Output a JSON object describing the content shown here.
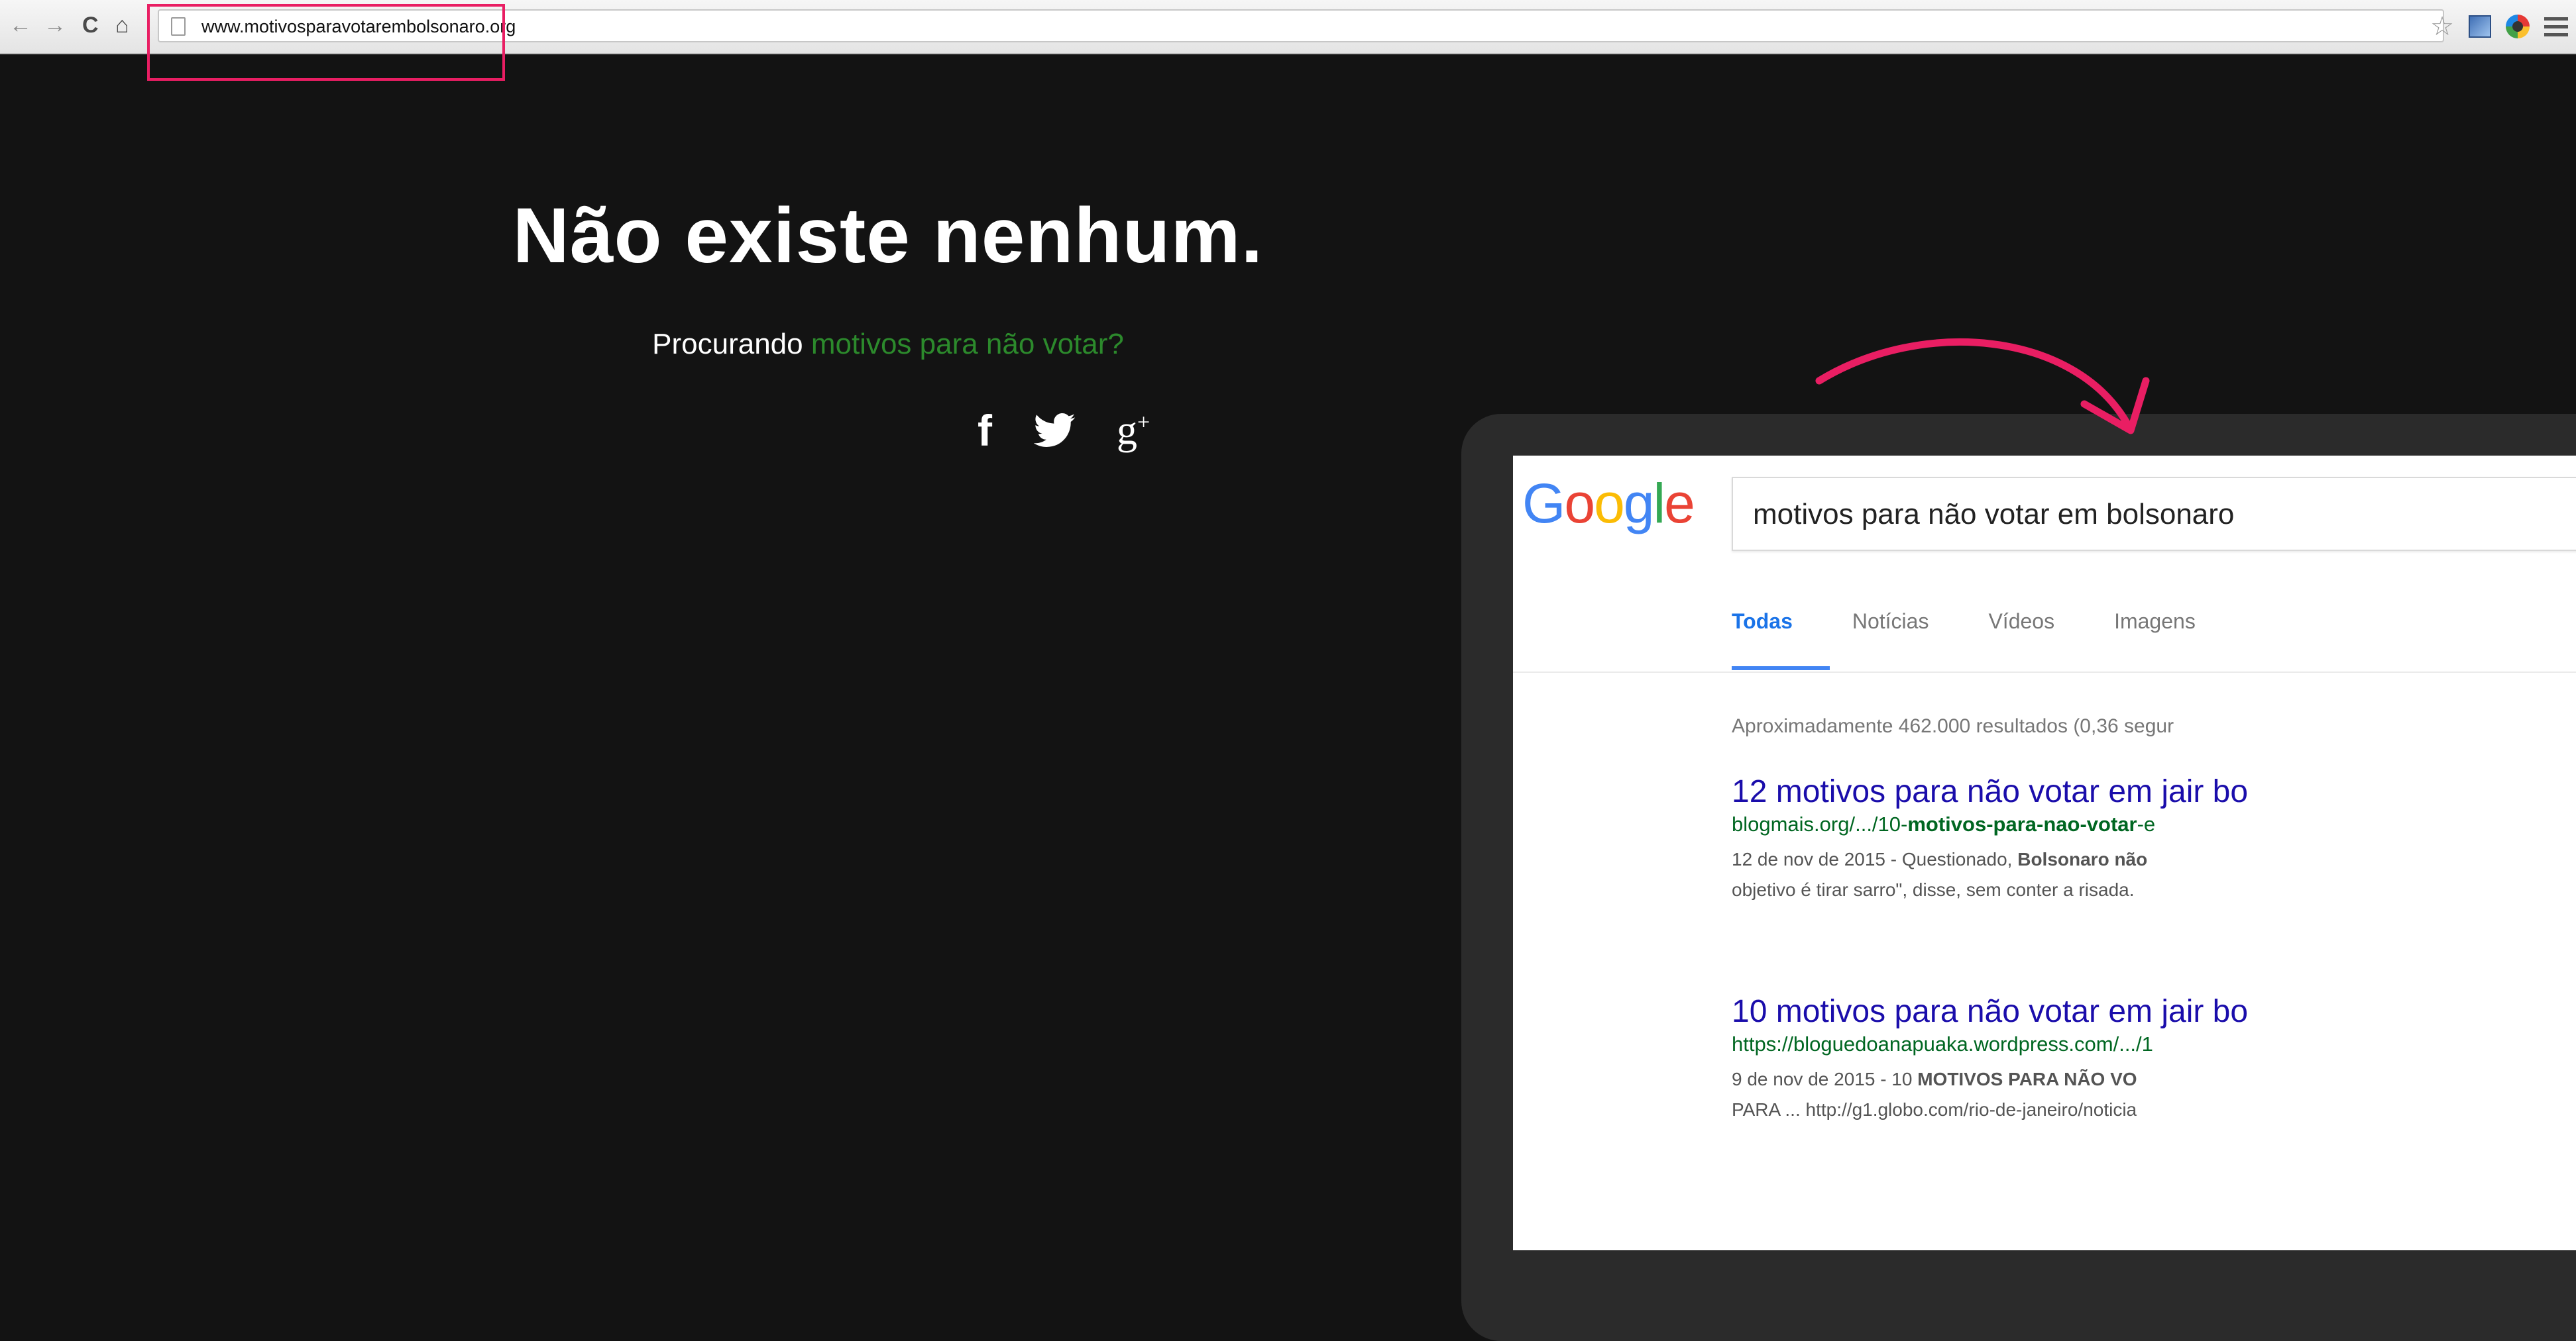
{
  "browser": {
    "url": "www.motivosparavotarembolsonaro.org",
    "nav": {
      "back": "←",
      "forward": "→",
      "reload": "C",
      "home": "⌂"
    },
    "icons": [
      "star-icon",
      "extension-icon",
      "color-extension-icon",
      "menu-icon"
    ]
  },
  "page": {
    "headline": "Não existe nenhum.",
    "subtitle_prefix": "Procurando ",
    "subtitle_link": "motivos para não votar?",
    "social": {
      "facebook": "f",
      "googleplus": "g",
      "googleplus_sup": "+"
    }
  },
  "screenshot": {
    "search_query": "motivos para não votar em bolsonaro",
    "tabs": [
      "Todas",
      "Notícias",
      "Vídeos",
      "Imagens"
    ],
    "stats": "Aproximadamente 462.000 resultados (0,36 segur",
    "results": [
      {
        "title": "12 motivos para não votar em jair bo",
        "url_prefix": "blogmais.org/.../10-",
        "url_bold": "motivos-para-nao-votar",
        "url_suffix": "-e",
        "snippet_line1_prefix": "12 de nov de 2015 - Questionado, ",
        "snippet_line1_bold": "Bolsonaro não",
        "snippet_line2": "objetivo é tirar sarro\", disse, sem conter a risada."
      },
      {
        "title": "10 motivos para não votar em jair bo",
        "url_prefix": "https://bloguedoanapuaka.wordpress.com/.../1",
        "url_bold": "",
        "url_suffix": "",
        "snippet_line1_prefix": "9 de nov de 2015 - 10 ",
        "snippet_line1_bold": "MOTIVOS PARA NÃO VO",
        "snippet_line2": "PARA ... http://g1.globo.com/rio-de-janeiro/noticia"
      }
    ]
  },
  "colors": {
    "highlight": "#e91e63",
    "accent_green": "#2c8a2c",
    "link_blue": "#1a0dab",
    "url_green": "#006621"
  }
}
